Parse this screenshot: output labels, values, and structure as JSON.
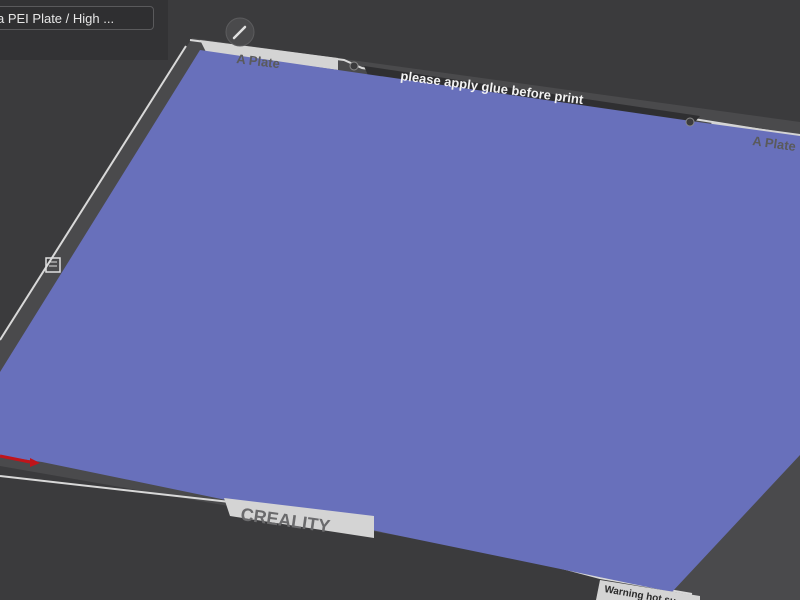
{
  "plate_selector": {
    "value": "a PEI Plate / High ..."
  },
  "bed": {
    "left_label": "A Plate",
    "right_label": "A Plate",
    "glue_notice": "please apply glue before print",
    "brand_logo": "CREALITY",
    "warning_text": "Warning hot su"
  },
  "colors": {
    "viewport_bg": "#3b3b3d",
    "bed_frame": "#4a4a4c",
    "bed_surface": "#6870bb",
    "bed_border": "#d9d9d9",
    "axis_x": "#c0141a"
  },
  "icons": {
    "edit_plate": "pencil-icon",
    "hot_warning": "hand-icon"
  }
}
